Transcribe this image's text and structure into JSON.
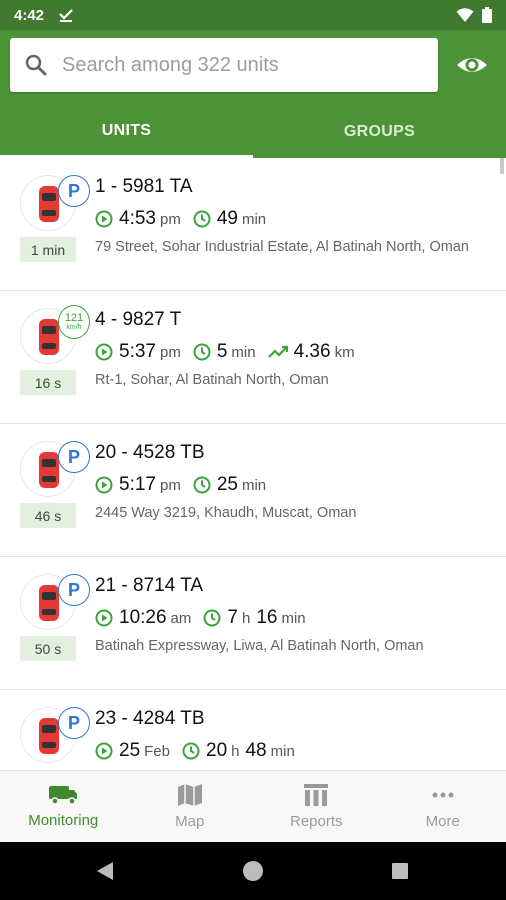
{
  "status_bar": {
    "time": "4:42",
    "icons": [
      "check-download-icon",
      "wifi-icon",
      "battery-icon"
    ]
  },
  "search": {
    "placeholder": "Search among 322 units"
  },
  "tabs": [
    {
      "label": "UNITS",
      "active": true
    },
    {
      "label": "GROUPS",
      "active": false
    }
  ],
  "units": [
    {
      "name": "1 - 5981 TA",
      "badge": "P",
      "age": "1 min",
      "time": "4:53",
      "time_suffix": "pm",
      "duration": "49",
      "duration_unit": "min",
      "address": "79 Street, Sohar Industrial Estate, Al Batinah North, Oman"
    },
    {
      "name": "4 - 9827 T",
      "speed": "121",
      "speed_unit": "km/h",
      "age": "16 s",
      "time": "5:37",
      "time_suffix": "pm",
      "duration": "5",
      "duration_unit": "min",
      "distance": "4.36",
      "distance_unit": "km",
      "address": "Rt-1, Sohar, Al Batinah North, Oman"
    },
    {
      "name": "20 - 4528 TB",
      "badge": "P",
      "age": "46 s",
      "time": "5:17",
      "time_suffix": "pm",
      "duration": "25",
      "duration_unit": "min",
      "address": "2445 Way 3219, Khaudh, Muscat, Oman"
    },
    {
      "name": "21 - 8714 TA",
      "badge": "P",
      "age": "50 s",
      "time": "10:26",
      "time_suffix": "am",
      "duration_h": "7",
      "duration_h_unit": "h",
      "duration": "16",
      "duration_unit": "min",
      "address": "Batinah Expressway, Liwa, Al Batinah North, Oman"
    },
    {
      "name": "23 - 4284 TB",
      "badge": "P",
      "time": "25",
      "time_suffix": "Feb",
      "duration_h": "20",
      "duration_h_unit": "h",
      "duration": "48",
      "duration_unit": "min"
    }
  ],
  "bottom_nav": [
    {
      "label": "Monitoring",
      "icon": "truck-icon",
      "active": true
    },
    {
      "label": "Map",
      "icon": "map-icon",
      "active": false
    },
    {
      "label": "Reports",
      "icon": "reports-icon",
      "active": false
    },
    {
      "label": "More",
      "icon": "more-dots-icon",
      "active": false
    }
  ],
  "colors": {
    "primary": "#4c9237",
    "status_bar": "#3f7a30",
    "accent_green": "#3aa43b",
    "parking_blue": "#2e76d4",
    "age_bg": "#e2f1df"
  }
}
